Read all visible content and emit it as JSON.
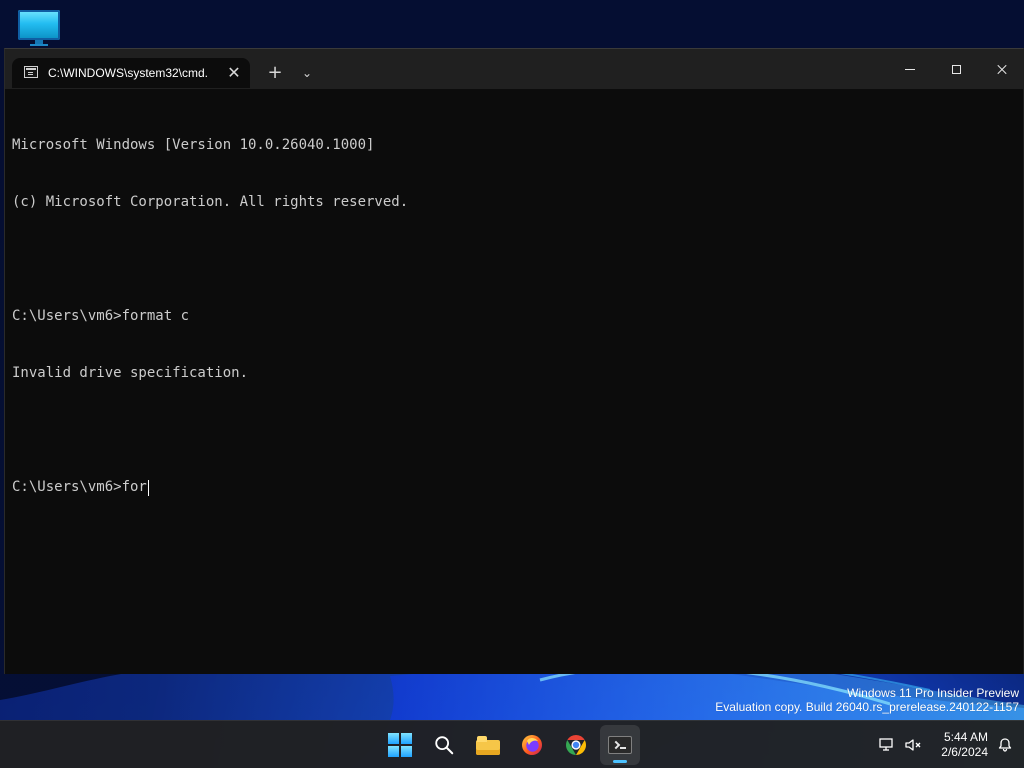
{
  "window": {
    "tab_title": "C:\\WINDOWS\\system32\\cmd.",
    "tab_close": "✕",
    "new_tab": "+",
    "dropdown": "⌄"
  },
  "console": {
    "lines": [
      "Microsoft Windows [Version 10.0.26040.1000]",
      "(c) Microsoft Corporation. All rights reserved.",
      "",
      "C:\\Users\\vm6>format c",
      "Invalid drive specification.",
      ""
    ],
    "prompt": "C:\\Users\\vm6>",
    "input": "for"
  },
  "watermark": {
    "line1": "Windows 11 Pro Insider Preview",
    "line2": "Evaluation copy. Build 26040.rs_prerelease.240122-1157"
  },
  "taskbar": {
    "time": "5:44 AM",
    "date": "2/6/2024",
    "apps": [
      "start-icon",
      "search-icon",
      "file-explorer-icon",
      "firefox-icon",
      "chrome-icon",
      "terminal-icon"
    ]
  },
  "colors": {
    "terminal_bg": "#0c0c0c",
    "titlebar_bg": "#202020",
    "text": "#cccccc",
    "accent": "#4cc2ff"
  }
}
